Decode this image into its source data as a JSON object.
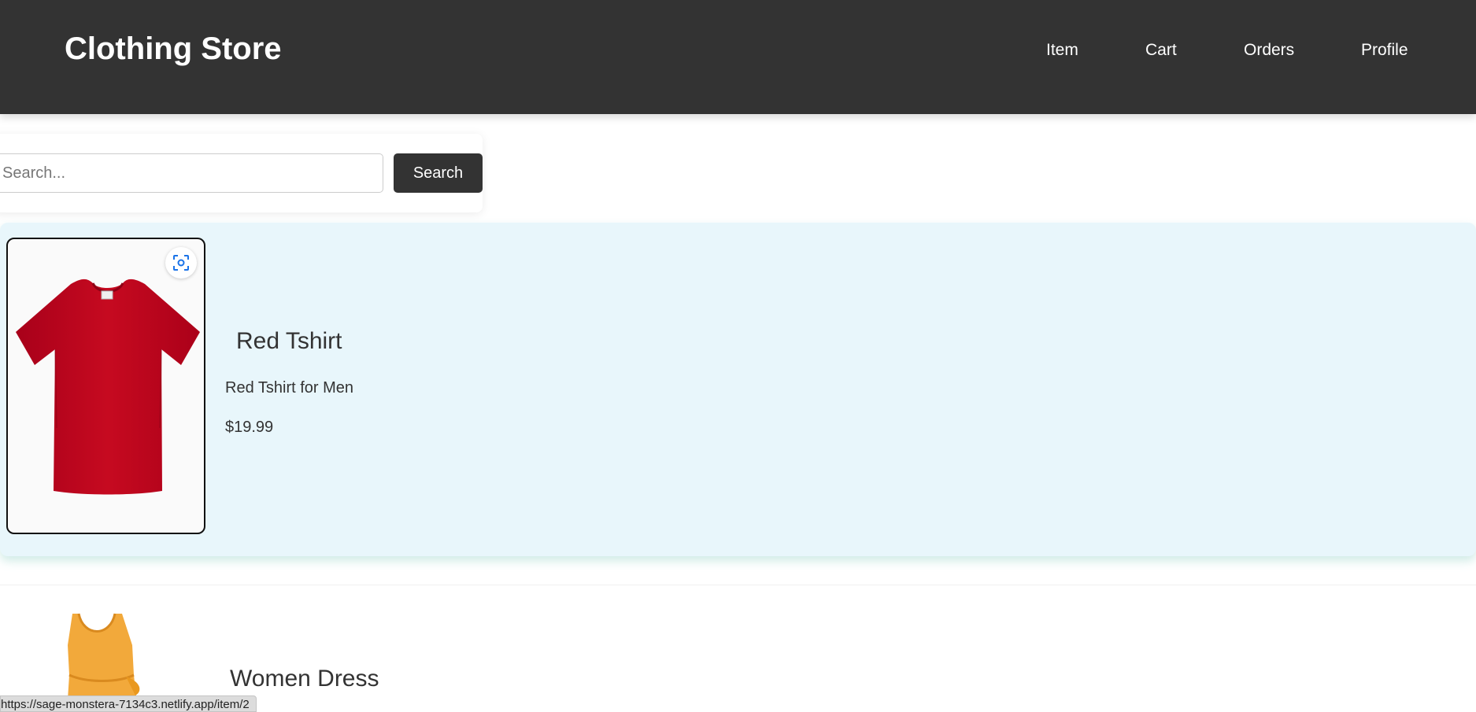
{
  "header": {
    "brand": "Clothing Store",
    "nav": [
      {
        "label": "Item"
      },
      {
        "label": "Cart"
      },
      {
        "label": "Orders"
      },
      {
        "label": "Profile"
      }
    ]
  },
  "search": {
    "placeholder": "Search...",
    "value": "",
    "button_label": "Search"
  },
  "items": [
    {
      "title": "Red Tshirt",
      "description": "Red Tshirt for Men",
      "price": "$19.99",
      "image_icon": "red-tshirt-image",
      "color": "#c0081d"
    },
    {
      "title": "Women Dress",
      "image_icon": "yellow-dress-image",
      "color": "#f2a93b"
    }
  ],
  "status_bar": {
    "url": "https://sage-monstera-7134c3.netlify.app/item/2"
  },
  "colors": {
    "header_bg": "#333333",
    "highlight_bg": "#e8f6fb",
    "button_bg": "#333333",
    "lens_icon": "#1a73e8"
  }
}
